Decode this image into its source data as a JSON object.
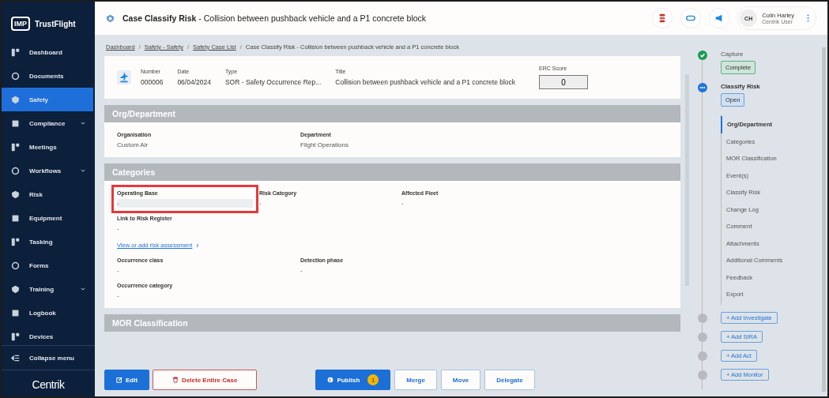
{
  "brand": {
    "logo": "IMP",
    "name": "TrustFlight"
  },
  "sidebar": {
    "items": [
      {
        "label": "Dashboard",
        "selected": false,
        "expandable": false
      },
      {
        "label": "Documents",
        "selected": false,
        "expandable": false
      },
      {
        "label": "Safety",
        "selected": true,
        "expandable": false
      },
      {
        "label": "Compliance",
        "selected": false,
        "expandable": true
      },
      {
        "label": "Meetings",
        "selected": false,
        "expandable": false
      },
      {
        "label": "Workflows",
        "selected": false,
        "expandable": true
      },
      {
        "label": "Risk",
        "selected": false,
        "expandable": false
      },
      {
        "label": "Equipment",
        "selected": false,
        "expandable": false
      },
      {
        "label": "Tasking",
        "selected": false,
        "expandable": false
      },
      {
        "label": "Forms",
        "selected": false,
        "expandable": false
      },
      {
        "label": "Training",
        "selected": false,
        "expandable": true
      },
      {
        "label": "Logbook",
        "selected": false,
        "expandable": false
      },
      {
        "label": "Devices",
        "selected": false,
        "expandable": false
      }
    ],
    "collapse_label": "Collapse menu",
    "footer_logo": "Centrik"
  },
  "header": {
    "title": "Case Classify Risk",
    "separator": "-",
    "subtitle": "Collision between pushback vehicle and a P1 concrete block",
    "user": {
      "initials": "CH",
      "name": "Colin Harley",
      "role": "Centrik User"
    }
  },
  "breadcrumbs": [
    {
      "label": "Dashboard",
      "link": true
    },
    {
      "separator": "/",
      "label": "Safety - Safety",
      "link": true
    },
    {
      "separator": "/",
      "label": "Safety Case List",
      "link": true
    },
    {
      "separator": "/",
      "label": "Case Classify Risk - Collision between pushback vehicle and a P1 concrete block",
      "link": false
    }
  ],
  "summary": {
    "fields": [
      {
        "label": "Number",
        "value": "000006"
      },
      {
        "label": "Date",
        "value": "06/04/2024"
      },
      {
        "label": "Type",
        "value": "SOR - Safety Occurrence Rep..."
      },
      {
        "label": "Title",
        "value": "Collision between pushback vehicle and a P1 concrete block"
      }
    ],
    "erc": {
      "label": "ERC Score",
      "value": "0"
    }
  },
  "sections": [
    {
      "title": "Org/Department",
      "rows": [
        {
          "kind": "fields",
          "fields": [
            {
              "label": "Organisation",
              "value": "Custom Air",
              "highlighted": false
            },
            {
              "label": "Department",
              "value": "Flight Operations",
              "highlighted": false
            }
          ]
        }
      ]
    },
    {
      "title": "Categories",
      "rows": [
        {
          "kind": "fields",
          "fields": [
            {
              "label": "Operating Base",
              "value": "-",
              "highlighted": true
            },
            {
              "label": "Risk Category",
              "value": "-",
              "highlighted": false
            },
            {
              "label": "Affected Fleet",
              "value": "-",
              "highlighted": false
            }
          ]
        },
        {
          "kind": "fields",
          "fields": [
            {
              "label": "Link to Risk Register",
              "value": "-",
              "highlighted": false
            }
          ]
        },
        {
          "kind": "link",
          "label": "View or add risk assessment",
          "icon": "›"
        },
        {
          "kind": "fields",
          "fields": [
            {
              "label": "Occurrence class",
              "value": "-",
              "highlighted": false
            },
            {
              "label": "Detection phase",
              "value": "-",
              "highlighted": false
            }
          ]
        },
        {
          "kind": "fields",
          "fields": [
            {
              "label": "Occurrence category",
              "value": "-",
              "highlighted": false
            }
          ]
        }
      ]
    },
    {
      "title": "MOR Classification"
    }
  ],
  "stepper": [
    {
      "kind": "complete",
      "label": "Capture",
      "badge": "Complete"
    },
    {
      "kind": "current",
      "label": "Classify Risk",
      "badge": "Open",
      "children": [
        {
          "label": "Org/Department",
          "selected": true
        },
        {
          "label": "Categories",
          "selected": false
        },
        {
          "label": "MOR Classification",
          "selected": false
        },
        {
          "label": "Event(s)",
          "selected": false
        },
        {
          "label": "Classify Risk",
          "selected": false
        },
        {
          "label": "Change Log",
          "selected": false
        },
        {
          "label": "Comment",
          "selected": false
        },
        {
          "label": "Attachments",
          "selected": false
        },
        {
          "label": "Additional Comments",
          "selected": false
        },
        {
          "label": "Feedback",
          "selected": false
        },
        {
          "label": "Export",
          "selected": false
        }
      ]
    },
    {
      "kind": "add",
      "label": "+ Add Investigate"
    },
    {
      "kind": "add",
      "label": "+ Add SIRA"
    },
    {
      "kind": "add",
      "label": "+ Add Act"
    },
    {
      "kind": "add",
      "label": "+ Add Monitor"
    }
  ],
  "actions": {
    "left": [
      {
        "kind": "primary",
        "label": "Edit"
      },
      {
        "kind": "danger",
        "label": "Delete Entire Case"
      }
    ],
    "right": [
      {
        "kind": "primary",
        "label": "Publish",
        "badge": "1"
      },
      {
        "kind": "outline",
        "label": "Merge"
      },
      {
        "kind": "outline",
        "label": "Move"
      },
      {
        "kind": "outline",
        "label": "Delegate"
      }
    ]
  }
}
